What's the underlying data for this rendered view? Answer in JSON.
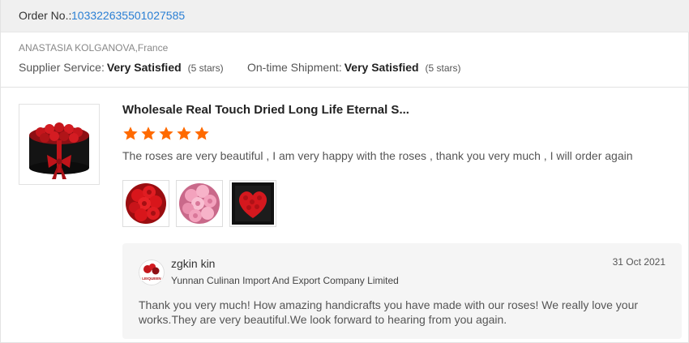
{
  "order": {
    "label": "Order No.:",
    "number": "103322635501027585"
  },
  "buyer": {
    "name_country": "ANASTASIA KOLGANOVA,France"
  },
  "ratings": [
    {
      "label": "Supplier Service:",
      "value": "Very Satisfied",
      "stars_text": "(5 stars)"
    },
    {
      "label": "On-time Shipment:",
      "value": "Very Satisfied",
      "stars_text": "(5 stars)"
    }
  ],
  "review": {
    "product_title": "Wholesale Real Touch Dried Long Life Eternal S...",
    "star_rating": 5,
    "star_color": "#ff6a00",
    "text": "The roses are very beautiful , I am very happy with the roses , thank you very much , I will order again",
    "photos": [
      "red-rose-ball",
      "pink-rose-ball",
      "red-rose-heart-frame"
    ]
  },
  "reply": {
    "seller_name": "zgkin kin",
    "company": "Yunnan Culinan Import And Export Company Limited",
    "date": "31 Oct 2021",
    "text": "Thank you very much! How amazing handicrafts you have made with our roses! We really love your works.They are very beautiful.We look forward to hearing from you again.",
    "avatar_text": "LEIQUEEN"
  },
  "colors": {
    "link": "#2a7fd4",
    "header_bg": "#f0f0f0",
    "reply_bg": "#f5f5f5"
  }
}
